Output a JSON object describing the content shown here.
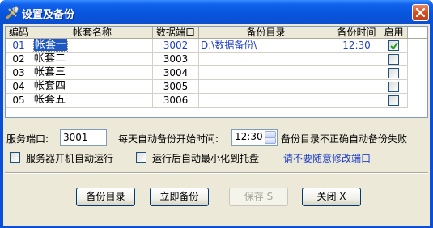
{
  "window": {
    "title": "设置及备份"
  },
  "table": {
    "columns": [
      "编码",
      "帐套名称",
      "数据端口",
      "备份目录",
      "备份时间",
      "启用"
    ],
    "rows": [
      {
        "code": "01",
        "name": "帐套一",
        "port": "3002",
        "dir": "D:\\数据备份\\",
        "time": "12:30",
        "enabled": true,
        "selected": true
      },
      {
        "code": "02",
        "name": "帐套二",
        "port": "3003",
        "dir": "",
        "time": "",
        "enabled": false,
        "selected": false
      },
      {
        "code": "03",
        "name": "帐套三",
        "port": "3004",
        "dir": "",
        "time": "",
        "enabled": false,
        "selected": false
      },
      {
        "code": "04",
        "name": "帐套四",
        "port": "3005",
        "dir": "",
        "time": "",
        "enabled": false,
        "selected": false
      },
      {
        "code": "05",
        "name": "帐套五",
        "port": "3006",
        "dir": "",
        "time": "",
        "enabled": false,
        "selected": false
      }
    ]
  },
  "settings": {
    "service_port_label": "服务端口:",
    "service_port_value": "3001",
    "daily_backup_label": "每天自动备份开始时间:",
    "daily_backup_time": "12:30",
    "backup_dir_warning": "备份目录不正确自动备份失败",
    "autostart_label": "服务器开机自动运行",
    "autostart_checked": false,
    "minimize_label": "运行后自动最小化到托盘",
    "minimize_checked": false,
    "port_notice": "请不要随意修改端口"
  },
  "buttons": {
    "backup_dir": "备份目录",
    "backup_now": "立即备份",
    "save": "保存",
    "save_key": "S",
    "close": "关闭",
    "close_key": "X"
  },
  "colors": {
    "titlebar": "#0a4fd8",
    "accent_text": "#1f3fc4",
    "selection": "#1f57c5",
    "dialog_bg": "#ece9d8"
  }
}
